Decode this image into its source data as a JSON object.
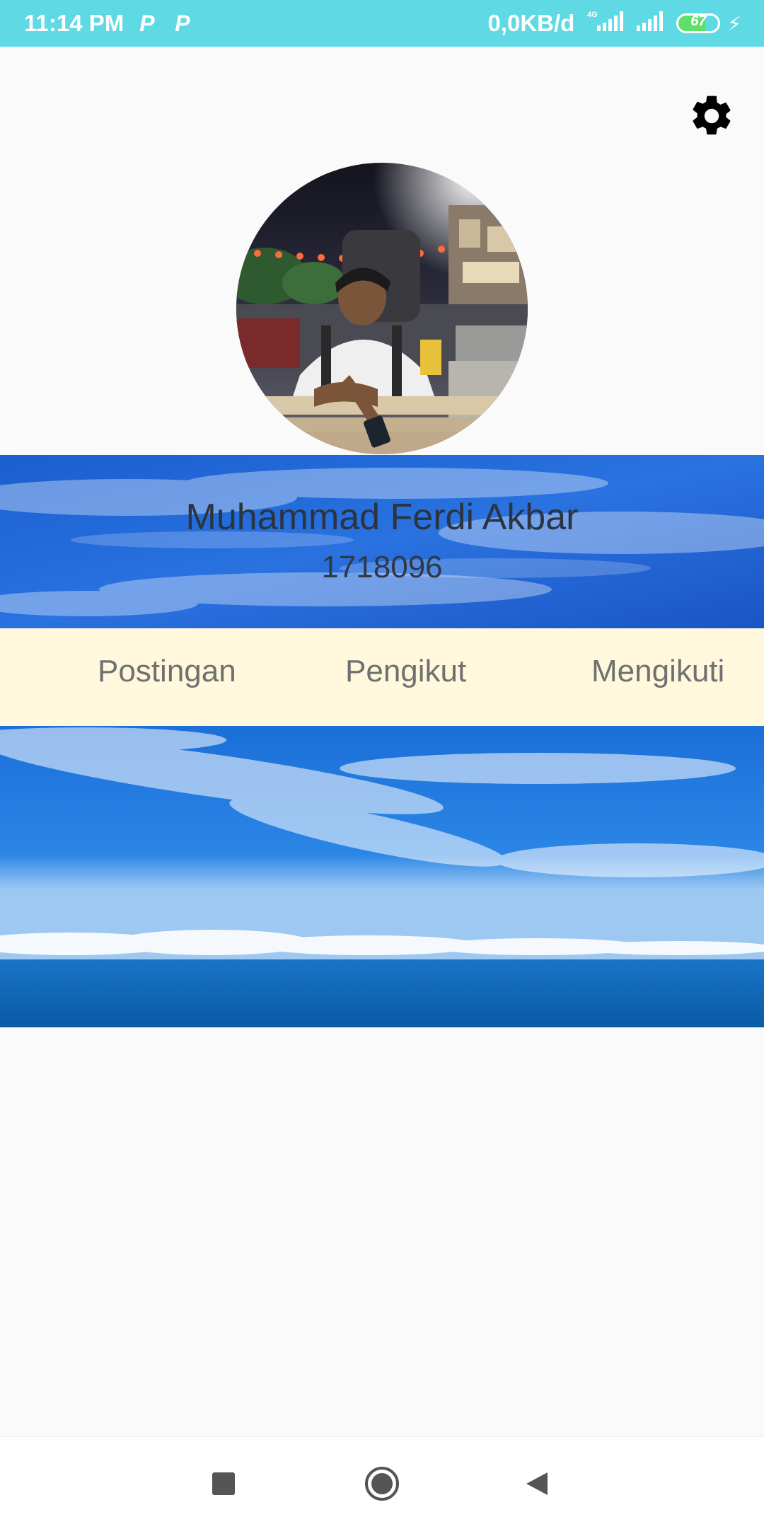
{
  "status_bar": {
    "time": "11:14 PM",
    "notif_icon_1": "P",
    "notif_icon_2": "P",
    "data_speed": "0,0KB/d",
    "network": "4G",
    "battery_level": "67",
    "battery_fraction": 0.67
  },
  "profile": {
    "name": "Muhammad Ferdi Akbar",
    "id": "1718096"
  },
  "tabs": {
    "posts": "Postingan",
    "followers": "Pengikut",
    "following": "Mengikuti"
  },
  "icons": {
    "settings": "gear-icon",
    "nav_recent": "square-icon",
    "nav_home": "circle-icon",
    "nav_back": "back-triangle-icon"
  },
  "colors": {
    "status_bar": "#5fd9e4",
    "tab_bar": "#fff8dc",
    "sky_blue": "#1d63d6"
  }
}
